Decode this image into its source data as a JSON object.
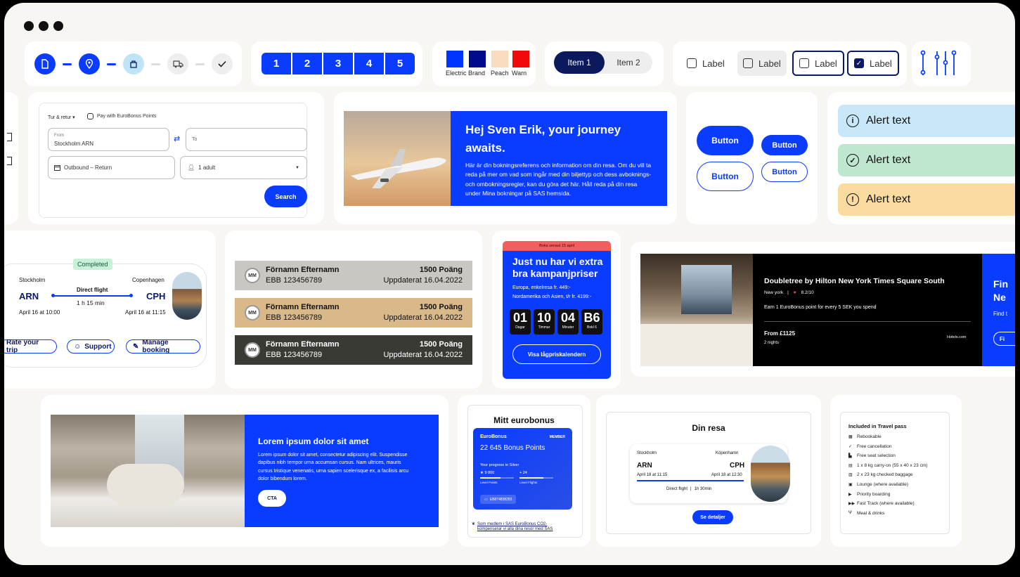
{
  "stepper": {
    "icons": [
      "document-icon",
      "location-pin-icon",
      "hand-luggage-icon",
      "truck-icon",
      "checkmark-icon"
    ]
  },
  "pagination": {
    "pages": [
      "1",
      "2",
      "3",
      "4",
      "5"
    ]
  },
  "swatches": [
    {
      "label": "Electric",
      "color": "#0033ff"
    },
    {
      "label": "Brand",
      "color": "#000a8c"
    },
    {
      "label": "Peach",
      "color": "#f8dcc0"
    },
    {
      "label": "Warn",
      "color": "#f00a0a"
    }
  ],
  "segmented": {
    "items": [
      "Item 1",
      "Item 2"
    ],
    "selected_index": 0
  },
  "checkboxes": [
    {
      "label": "Label",
      "checked": false,
      "state": "default"
    },
    {
      "label": "Label",
      "checked": false,
      "state": "hover"
    },
    {
      "label": "Label",
      "checked": false,
      "state": "focus"
    },
    {
      "label": "Label",
      "checked": true,
      "state": "focus"
    }
  ],
  "flight_search": {
    "trip_type": "Tur & retur",
    "eurobonus_label": "Pay with EuroBonus Points",
    "from_label": "From",
    "from_value": "Stockholm ARN",
    "to_placeholder": "To",
    "dates": "Outbound  –  Return",
    "passengers": "1 adult",
    "search_button": "Search"
  },
  "hero": {
    "title": "Hej Sven Erik, your journey awaits.",
    "body": "Här är din bokningsreferens och information om din resa. Om du vill ta reda på mer om vad som ingår med din biljettyp och dess avboknings- och ombokningsregler, kan du göra det här. Håll reda på din resa under Mina bokningar på SAS hemsida."
  },
  "buttons": {
    "labels": [
      "Button",
      "Button",
      "Button",
      "Button"
    ]
  },
  "alerts": [
    {
      "text": "Alert text",
      "kind": "info",
      "color": "#c8e8fa",
      "icon": "info-icon"
    },
    {
      "text": "Alert text",
      "kind": "success",
      "color": "#bfe6cf",
      "icon": "check-circle-icon"
    },
    {
      "text": "Alert text",
      "kind": "warning",
      "color": "#fbdca0",
      "icon": "warning-icon"
    }
  ],
  "booking": {
    "status": "Completed",
    "from_city": "Stockholm",
    "from_code": "ARN",
    "from_time": "April 16 at 10:00",
    "to_city": "Copenhagen",
    "to_code": "CPH",
    "to_time": "April 16 at 11:15",
    "flight_type": "Direct flight",
    "duration": "1 h 15 min",
    "actions": [
      "Rate your trip",
      "Support",
      "Manage booking"
    ]
  },
  "members": [
    {
      "initials": "MM",
      "name": "Förnamn Efternamn",
      "code": "EBB 123456789",
      "points": "1500 Poäng",
      "updated": "Uppdaterat 16.04.2022",
      "bg": "#c9c7c1",
      "fg": "#111"
    },
    {
      "initials": "MM",
      "name": "Förnamn Efternamn",
      "code": "EBB 123456789",
      "points": "1500 Poäng",
      "updated": "Uppdaterat 16.04.2022",
      "bg": "#d9b88a",
      "fg": "#111"
    },
    {
      "initials": "MM",
      "name": "Förnamn Efternamn",
      "code": "EBB 123456789",
      "points": "1500 Poäng",
      "updated": "Uppdaterat 16.04.2022",
      "bg": "#3a3a35",
      "fg": "#fff"
    }
  ],
  "campaign": {
    "banner": "Boka senast 15 april",
    "title": "Just nu har vi extra bra kampanjpriser",
    "line1": "Europa, enkelresa fr. 449:-",
    "line2": "Nordamerika och Asien, t/r fr. 4199:-",
    "countdown": [
      {
        "v": "01",
        "l": "Dagar"
      },
      {
        "v": "10",
        "l": "Timmar"
      },
      {
        "v": "04",
        "l": "Minuter"
      },
      {
        "v": "B6",
        "l": "Bokl 6"
      }
    ],
    "cta": "Visa lågpriskalendern"
  },
  "hotel": {
    "name": "Doubletree by Hilton New York Times Square South",
    "location": "New york",
    "rating": "8.2/10",
    "offer": "Earn 1 EuroBonus point for every 5 SEK you spend",
    "price": "From £1125",
    "nights": "2 nights",
    "provider": "Hotels.com",
    "side_title_1": "Fin",
    "side_title_2": "Ne",
    "side_sub": "Find t",
    "side_btn": "Fi"
  },
  "promo": {
    "title": "Lorem ipsum dolor sit amet",
    "body": "Lorem ipsum dolor sit amet, consectetur adipiscing elit. Suspendisse dapibus nibh tempor urna accumsan cursus. Nam ultrices, mauris cursus tristique venenatis, urna sapien scelerisque ex, a facilisis arcu dolor bibendum lorem.",
    "cta": "CTA"
  },
  "eurobonus": {
    "heading": "Mitt eurobonus",
    "brand": "EuroBonus",
    "tier": "MEMBER",
    "points": "22 645 Bonus Points",
    "progress_label": "Your progress to Silver",
    "level_points": "9 800",
    "level_points_label": "Level Points",
    "level_flights": "+ 24",
    "level_flights_label": "Level Flights",
    "level_points_progress": 0.6,
    "level_flights_progress": 0.7,
    "member_id": "EB874838283",
    "link": "Som medlem i SAS EuroBonus CO2-kompenserar vi alla dina resor med SAS"
  },
  "trip": {
    "heading": "Din resa",
    "from_city": "Stockholm",
    "from_code": "ARN",
    "from_time": "April 18 at 11:15",
    "to_city": "Köpenhamn",
    "to_code": "CPH",
    "to_time": "April 18 at 12:30",
    "flight": "Direct flight",
    "duration": "1h 30min",
    "cta": "Se detaljer"
  },
  "travel_pass": {
    "heading": "Included in Travel pass",
    "items": [
      {
        "icon": "calendar-icon",
        "text": "Rebookable"
      },
      {
        "icon": "check-icon",
        "text": "Free cancellation"
      },
      {
        "icon": "seat-icon",
        "text": "Free seat selection"
      },
      {
        "icon": "carry-on-icon",
        "text": "1 x 8 kg carry-on (55 x 40 x 23 cm)"
      },
      {
        "icon": "baggage-icon",
        "text": "2 x 23 kg checked baggage"
      },
      {
        "icon": "lounge-icon",
        "text": "Lounge  (where available)"
      },
      {
        "icon": "priority-icon",
        "text": "Priority boarding"
      },
      {
        "icon": "fast-track-icon",
        "text": "Fast Track (where available)"
      },
      {
        "icon": "meal-icon",
        "text": "Meal & drinks"
      }
    ]
  }
}
